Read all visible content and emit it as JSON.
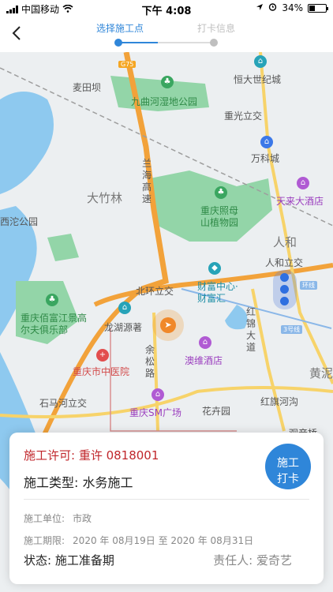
{
  "status_bar": {
    "carrier": "中国移动",
    "time": "下午 4:08",
    "battery": "34%",
    "battery_level": 0.34
  },
  "nav": {
    "steps": [
      "选择施工点",
      "打卡信息"
    ],
    "current_step": 1
  },
  "map": {
    "labels": {
      "g75": "G75",
      "maitianba": "麦田坝",
      "jiuquhe": "九曲河湿地公园",
      "hengda": "恒大世纪城",
      "chongguang": "重光立交",
      "wanke": "万科城",
      "daxing": "大竹林",
      "lanhai": "兰海高速",
      "zhaomu": "重庆照母山植物园",
      "tianlai": "天来大酒店",
      "xituo": "西沱公园",
      "renhe": "人和",
      "renhe_lijiao": "人和立交",
      "beihuan": "北环立交",
      "caifu": "财富中心·财富汇",
      "huanxian": "环线",
      "baifu": "重庆佰富江景高尔夫俱乐部",
      "longhu": "龙湖源著",
      "hongjin": "红锦大道",
      "line3": "3号线",
      "aowei": "澳维酒店",
      "zhongyi": "重庆市中医院",
      "yusong": "余松路",
      "huangni": "黄泥",
      "shimahe": "石马河立交",
      "sm": "重庆SM广场",
      "huahui": "花卉园",
      "hongqi": "红旗河沟",
      "guanyinqiao": "观音桥"
    }
  },
  "card": {
    "permit": "施工许可: 重许 0818001",
    "type": "施工类型: 水务施工",
    "punch_line1": "施工",
    "punch_line2": "打卡",
    "unit_label": "施工单位:",
    "unit_value": "市政",
    "period_label": "施工期限:",
    "period_value": "2020 年 08月19日 至 2020 年 08月31日",
    "status": "状态: 施工准备期",
    "owner": "责任人: 爱奇艺"
  },
  "colors": {
    "accent": "#2f86d9",
    "permit_red": "#c0262b",
    "road_orange": "#f2a23a",
    "park_green": "#8fd3a4",
    "water_blue": "#7fc0ea"
  }
}
